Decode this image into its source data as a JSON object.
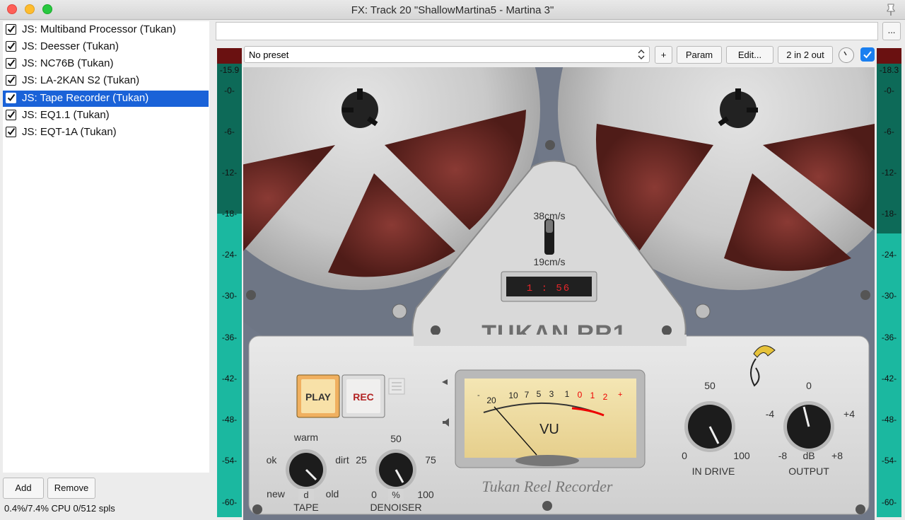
{
  "window": {
    "title": "FX: Track 20 \"ShallowMartina5 - Martina 3\""
  },
  "fx_list": [
    {
      "label": "JS: Multiband Processor (Tukan)",
      "enabled": true,
      "selected": false
    },
    {
      "label": "JS: Deesser (Tukan)",
      "enabled": true,
      "selected": false
    },
    {
      "label": "JS: NC76B (Tukan)",
      "enabled": true,
      "selected": false
    },
    {
      "label": "JS: LA-2KAN S2 (Tukan)",
      "enabled": true,
      "selected": false
    },
    {
      "label": "JS: Tape Recorder (Tukan)",
      "enabled": true,
      "selected": true
    },
    {
      "label": "JS: EQ1.1 (Tukan)",
      "enabled": true,
      "selected": false
    },
    {
      "label": "JS: EQT-1A (Tukan)",
      "enabled": true,
      "selected": false
    }
  ],
  "buttons": {
    "add": "Add",
    "remove": "Remove",
    "dots": "...",
    "plus": "+",
    "param": "Param",
    "edit": "Edit...",
    "io": "2 in 2 out"
  },
  "status": {
    "cpu": "0.4%/7.4% CPU 0/512 spls"
  },
  "preset": {
    "value": "No preset"
  },
  "meters": {
    "left_peak": "-15.9",
    "right_peak": "-18.3",
    "ticks": [
      "-0-",
      "-6-",
      "-12-",
      "-18-",
      "-24-",
      "-30-",
      "-36-",
      "-42-",
      "-48-",
      "-54-",
      "-60-"
    ]
  },
  "plugin": {
    "brand": "TUKAN RR1",
    "speed_high": "38cm/s",
    "speed_low": "19cm/s",
    "counter": "1 : 56",
    "play": "PLAY",
    "rec": "REC",
    "tape": {
      "label": "TAPE",
      "top": "warm",
      "left": "ok",
      "right": "dirt",
      "bottom_left": "new",
      "bottom_right": "old",
      "center": "d"
    },
    "denoiser": {
      "label": "DENOISER",
      "top": "50",
      "left_val": "25",
      "right_val": "75",
      "min": "0",
      "max": "100",
      "center": "%"
    },
    "vu": {
      "label": "VU",
      "scale": [
        "20",
        "10",
        "7",
        "5",
        "3",
        "1",
        "0",
        "1",
        "2"
      ],
      "minus": "-",
      "plus": "+"
    },
    "in_drive": {
      "label": "IN DRIVE",
      "top": "50",
      "min": "0",
      "max": "100"
    },
    "output": {
      "label": "OUTPUT",
      "top": "0",
      "left": "-4",
      "right": "+4",
      "min": "-8",
      "max": "+8",
      "center": "dB"
    },
    "footer": "Tukan Reel Recorder"
  },
  "colors": {
    "selection": "#1a62d8",
    "meter": "#1bb8a0",
    "clip": "#6a1111",
    "counter": "#e8262a"
  }
}
